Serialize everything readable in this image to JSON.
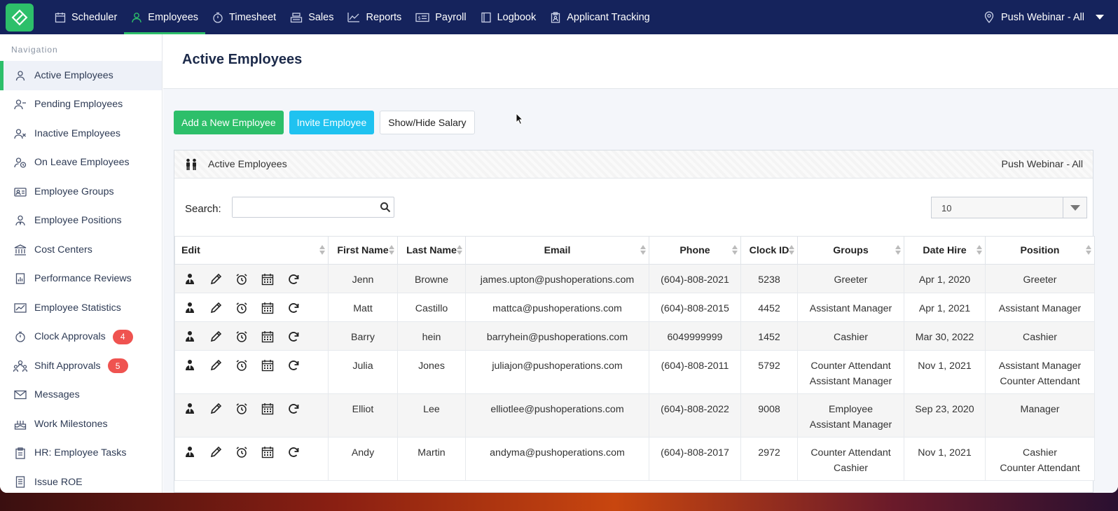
{
  "topnav": {
    "items": [
      {
        "label": "Scheduler",
        "icon": "calendar-icon"
      },
      {
        "label": "Employees",
        "icon": "user-icon",
        "active": true
      },
      {
        "label": "Timesheet",
        "icon": "stopwatch-icon"
      },
      {
        "label": "Sales",
        "icon": "register-icon"
      },
      {
        "label": "Reports",
        "icon": "chart-line-icon"
      },
      {
        "label": "Payroll",
        "icon": "paycheck-icon"
      },
      {
        "label": "Logbook",
        "icon": "book-icon"
      },
      {
        "label": "Applicant Tracking",
        "icon": "clipboard-icon"
      }
    ],
    "location": "Push Webinar - All"
  },
  "sidebar": {
    "title": "Navigation",
    "items": [
      {
        "label": "Active Employees",
        "active": true
      },
      {
        "label": "Pending Employees"
      },
      {
        "label": "Inactive Employees"
      },
      {
        "label": "On Leave Employees"
      },
      {
        "label": "Employee Groups"
      },
      {
        "label": "Employee Positions"
      },
      {
        "label": "Cost Centers"
      },
      {
        "label": "Performance Reviews"
      },
      {
        "label": "Employee Statistics"
      },
      {
        "label": "Clock Approvals",
        "badge": "4"
      },
      {
        "label": "Shift Approvals",
        "badge": "5"
      },
      {
        "label": "Messages"
      },
      {
        "label": "Work Milestones"
      },
      {
        "label": "HR: Employee Tasks"
      },
      {
        "label": "Issue ROE"
      }
    ]
  },
  "page": {
    "title": "Active Employees",
    "buttons": {
      "add": "Add a New Employee",
      "invite": "Invite Employee",
      "salary": "Show/Hide Salary"
    }
  },
  "panel": {
    "title": "Active Employees",
    "location": "Push Webinar - All",
    "search_label": "Search:",
    "search_value": "",
    "page_size": "10"
  },
  "table": {
    "headers": [
      "Edit",
      "First Name",
      "Last Name",
      "Email",
      "Phone",
      "Clock ID",
      "Groups",
      "Date Hire",
      "Position"
    ],
    "rows": [
      {
        "first": "Jenn",
        "last": "Browne",
        "email": "james.upton@pushoperations.com",
        "phone": "(604)-808-2021",
        "clock": "5238",
        "groups": [
          "Greeter"
        ],
        "hire": "Apr 1, 2020",
        "position": [
          "Greeter"
        ]
      },
      {
        "first": "Matt",
        "last": "Castillo",
        "email": "mattca@pushoperations.com",
        "phone": "(604)-808-2015",
        "clock": "4452",
        "groups": [
          "Assistant Manager"
        ],
        "hire": "Apr 1, 2021",
        "position": [
          "Assistant Manager"
        ]
      },
      {
        "first": "Barry",
        "last": "hein",
        "email": "barryhein@pushoperations.com",
        "phone": "6049999999",
        "clock": "1452",
        "groups": [
          "Cashier"
        ],
        "hire": "Mar 30, 2022",
        "position": [
          "Cashier"
        ]
      },
      {
        "first": "Julia",
        "last": "Jones",
        "email": "juliajon@pushoperations.com",
        "phone": "(604)-808-2011",
        "clock": "5792",
        "groups": [
          "Counter Attendant",
          "Assistant Manager"
        ],
        "hire": "Nov 1, 2021",
        "position": [
          "Assistant Manager",
          "Counter Attendant"
        ]
      },
      {
        "first": "Elliot",
        "last": "Lee",
        "email": "elliotlee@pushoperations.com",
        "phone": "(604)-808-2022",
        "clock": "9008",
        "groups": [
          "Employee",
          "Assistant Manager"
        ],
        "hire": "Sep 23, 2020",
        "position": [
          "Manager"
        ]
      },
      {
        "first": "Andy",
        "last": "Martin",
        "email": "andyma@pushoperations.com",
        "phone": "(604)-808-2017",
        "clock": "2972",
        "groups": [
          "Counter Attendant",
          "Cashier"
        ],
        "hire": "Nov 1, 2021",
        "position": [
          "Cashier",
          "Counter Attendant"
        ]
      }
    ]
  },
  "colors": {
    "topbar": "#15235c",
    "accent": "#2dbf6a",
    "invite": "#1fc2f0",
    "badge": "#ef5350"
  }
}
